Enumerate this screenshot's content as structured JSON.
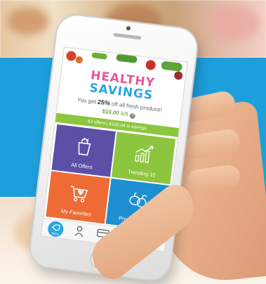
{
  "app": {
    "logo_line1": "HEALTHY",
    "logo_line2": "SAVINGS",
    "tagline_prefix": "You get ",
    "tagline_percent": "25%",
    "tagline_suffix": " off all fresh produce!",
    "amount_left": "$10.00",
    "amount_left_suffix": " left",
    "info_symbol": "?",
    "stats": "63 offers  |  $190.04 in savings"
  },
  "tiles": [
    {
      "label": "All Offers",
      "icon": "grocery-bag-icon",
      "color": "#5b4fa6"
    },
    {
      "label": "Trending 10",
      "icon": "trending-chart-icon",
      "color": "#8cc63f"
    },
    {
      "label": "My Favorites",
      "icon": "heart-cart-icon",
      "color": "#ef6b35"
    },
    {
      "label": "Produce Perks",
      "icon": "produce-icon",
      "color": "#1e8fd0"
    }
  ],
  "tabbar": {
    "active_label": "Offers",
    "tabs": [
      "offers-icon",
      "profile-icon",
      "card-icon",
      "location-icon",
      "barcode-icon"
    ]
  },
  "colors": {
    "background_band": "#1e9fdc",
    "accent_green": "#8cc63f",
    "accent_blue": "#2aa5dd",
    "accent_pink": "#e45a9a"
  }
}
